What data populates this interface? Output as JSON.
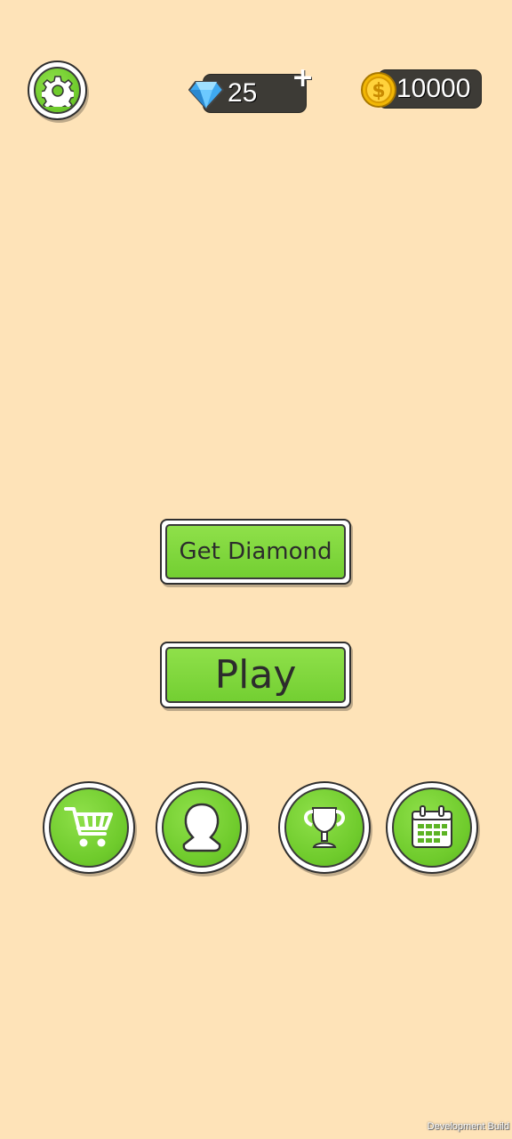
{
  "top_bar": {
    "diamond_count": "25",
    "diamond_plus": "+",
    "coin_count": "10000"
  },
  "main": {
    "get_diamond_label": "Get Diamond",
    "play_label": "Play"
  },
  "bottom_bar": {
    "icons": [
      "shopping-cart-icon",
      "profile-icon",
      "trophy-icon",
      "calendar-icon"
    ]
  },
  "footer": {
    "build_label": "Development Build"
  },
  "colors": {
    "background": "#FEE3B8",
    "button_green": "#73CF32",
    "pill_dark": "#3D3B36"
  }
}
